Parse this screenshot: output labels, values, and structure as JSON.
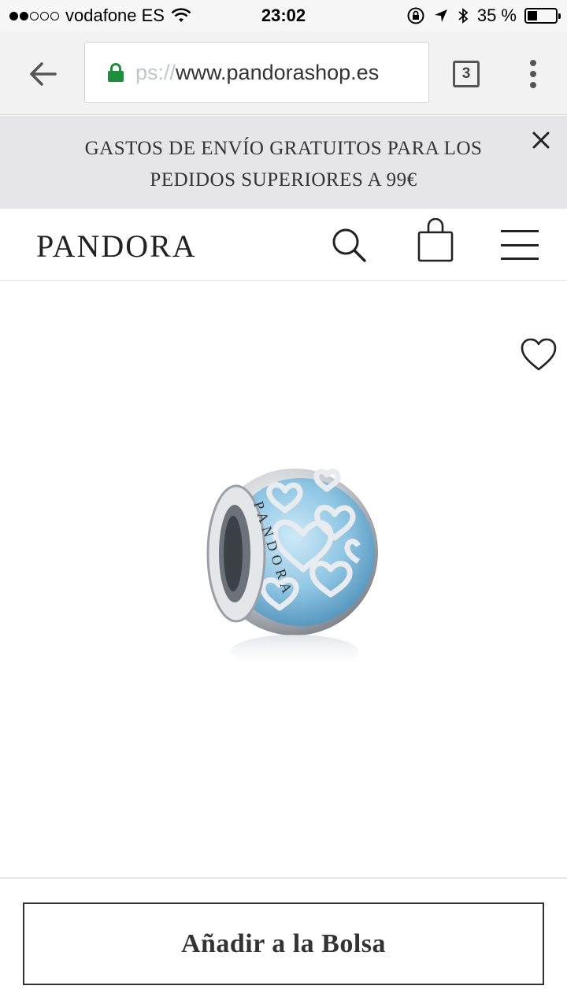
{
  "status_bar": {
    "carrier": "vodafone ES",
    "time": "23:02",
    "battery_percent": "35 %",
    "battery_level": 0.35,
    "signal_bars_filled": 2,
    "signal_bars_total": 5
  },
  "browser": {
    "url_scheme_faded": "ps://",
    "url_host": "www.pandorashop.es",
    "tab_count": "3"
  },
  "promo_banner": {
    "text": "GASTOS DE ENVÍO GRATUITOS PARA LOS PEDIDOS SUPERIORES A 99€"
  },
  "header": {
    "logo": "PANDORA"
  },
  "product": {
    "engraving": "PANDORA"
  },
  "actions": {
    "add_to_bag_label": "Añadir a la Bolsa"
  },
  "colors": {
    "lock_green": "#1e8e3e",
    "promo_bg": "#e6e5ea",
    "charm_blue": "#8fc6e4"
  },
  "icons": [
    "back-arrow-icon",
    "lock-icon",
    "tabs-icon",
    "more-vert-icon",
    "close-icon",
    "search-icon",
    "shopping-bag-icon",
    "hamburger-menu-icon",
    "heart-icon",
    "wifi-icon",
    "location-arrow-icon",
    "bluetooth-icon",
    "rotation-lock-icon",
    "battery-icon"
  ]
}
